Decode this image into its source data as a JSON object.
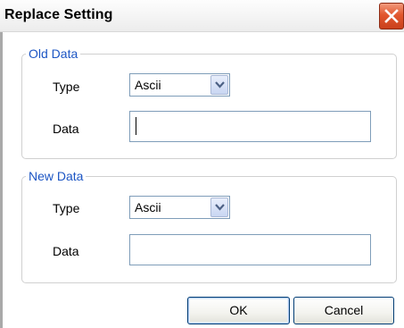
{
  "window": {
    "title": "Replace Setting"
  },
  "old_data": {
    "legend": "Old Data",
    "type_label": "Type",
    "type_value": "Ascii",
    "data_label": "Data",
    "data_value": ""
  },
  "new_data": {
    "legend": "New Data",
    "type_label": "Type",
    "type_value": "Ascii",
    "data_label": "Data",
    "data_value": ""
  },
  "buttons": {
    "ok_label": "OK",
    "cancel_label": "Cancel"
  },
  "colors": {
    "legend_text": "#1d56c4",
    "close_button": "#e2572e"
  },
  "icons": {
    "close": "close-icon",
    "dropdown": "chevron-down-icon"
  }
}
